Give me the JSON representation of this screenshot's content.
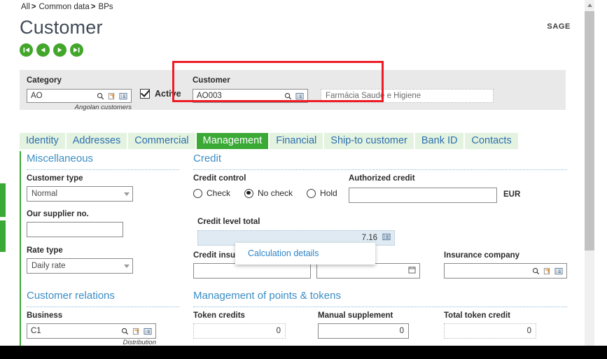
{
  "breadcrumb": {
    "items": [
      "All",
      "Common data",
      "BPs"
    ],
    "separator": ">"
  },
  "header": {
    "title": "Customer",
    "brand": "SAGE",
    "nav_buttons": [
      {
        "name": "first-record",
        "glyph": "first"
      },
      {
        "name": "previous-record",
        "glyph": "prev"
      },
      {
        "name": "next-record",
        "glyph": "next"
      },
      {
        "name": "last-record",
        "glyph": "last"
      }
    ]
  },
  "record_header": {
    "category": {
      "label": "Category",
      "value": "AO",
      "hint": "Angolan customers"
    },
    "active": {
      "label": "Active",
      "checked": true
    },
    "customer": {
      "label": "Customer",
      "value": "AO003"
    },
    "customer_name": {
      "value": "Farmácia Saude e Higiene"
    }
  },
  "tabs": [
    {
      "label": "Identity",
      "active": false
    },
    {
      "label": "Addresses",
      "active": false
    },
    {
      "label": "Commercial",
      "active": false
    },
    {
      "label": "Management",
      "active": true
    },
    {
      "label": "Financial",
      "active": false
    },
    {
      "label": "Ship-to customer",
      "active": false
    },
    {
      "label": "Bank ID",
      "active": false
    },
    {
      "label": "Contacts",
      "active": false
    }
  ],
  "sections": {
    "miscellaneous": {
      "title": "Miscellaneous",
      "customer_type": {
        "label": "Customer type",
        "value": "Normal"
      },
      "supplier_no": {
        "label": "Our supplier no.",
        "value": ""
      },
      "rate_type": {
        "label": "Rate type",
        "value": "Daily rate"
      }
    },
    "credit": {
      "title": "Credit",
      "credit_control": {
        "label": "Credit control",
        "options": [
          {
            "label": "Check",
            "selected": false
          },
          {
            "label": "No check",
            "selected": true
          },
          {
            "label": "Hold",
            "selected": false
          }
        ]
      },
      "authorized_credit": {
        "label": "Authorized credit",
        "value": "",
        "currency": "EUR"
      },
      "credit_level_total": {
        "label": "Credit level total",
        "value": "7.16"
      },
      "credit_insurance": {
        "label": "Credit insura",
        "value": "",
        "date_value": ""
      },
      "insurance_company": {
        "label": "Insurance company",
        "value": ""
      }
    },
    "customer_relations": {
      "title": "Customer relations",
      "business": {
        "label": "Business",
        "value": "C1",
        "hint": "Distribution"
      }
    },
    "points_tokens": {
      "title": "Management of points & tokens",
      "token_credits": {
        "label": "Token credits",
        "value": "0"
      },
      "manual_supplement": {
        "label": "Manual supplement",
        "value": "0"
      },
      "total_token_credit": {
        "label": "Total token credit",
        "value": "0"
      }
    }
  },
  "popup": {
    "items": [
      {
        "label": "Calculation details"
      }
    ]
  },
  "colors": {
    "green": "#3aa935",
    "blue_link": "#2f85c8",
    "section_title": "#3b8dc4",
    "highlight_red": "#ee1c25",
    "field_highlight_bg": "#dfeaf3"
  }
}
